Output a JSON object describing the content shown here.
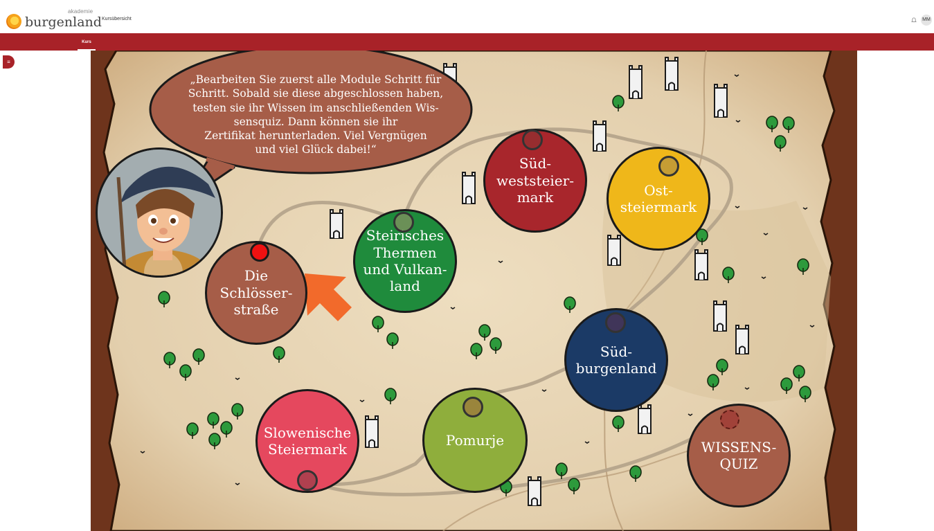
{
  "header": {
    "logo_small": "akademie",
    "logo_big": "burgenland",
    "nav_link": "Kursübersicht",
    "user_initials": "MM",
    "icons": [
      "bell-icon",
      "menu-icon"
    ]
  },
  "tabs": {
    "active": "Kurs"
  },
  "colors": {
    "brand_red": "#a82228",
    "parchment": "#e6d3b3"
  },
  "speech": {
    "text": "„Bearbeiten Sie zuerst alle Module Schritt für\nSchritt. Sobald sie diese abgeschlossen haben,\ntesten sie ihr Wissen im anschließenden Wis-\nsensquiz. Dann können sie ihr\nZertifikat herunterladen. Viel Vergnügen\nund viel Glück dabei!“"
  },
  "modules": [
    {
      "label": "Die\nSchlösser-\nstraße",
      "color": "#a65d48",
      "status": "current"
    },
    {
      "label": "Steirisches\nThermen\nund Vulkan-\nland",
      "color": "#1f8b3c",
      "status": "locked"
    },
    {
      "label": "Süd-\nweststeier-\nmark",
      "color": "#a8262c",
      "status": "locked"
    },
    {
      "label": "Ost-\nsteiermark",
      "color": "#efb71a",
      "status": "locked"
    },
    {
      "label": "Süd-\nburgenland",
      "color": "#1b3a66",
      "status": "locked"
    },
    {
      "label": "Pomurje",
      "color": "#8fae3c",
      "status": "locked"
    },
    {
      "label": "Slowenische\nSteiermark",
      "color": "#e5485e",
      "status": "locked"
    },
    {
      "label": "WISSENS-\nQUIZ",
      "color": "#a65d48",
      "status": "locked"
    }
  ]
}
